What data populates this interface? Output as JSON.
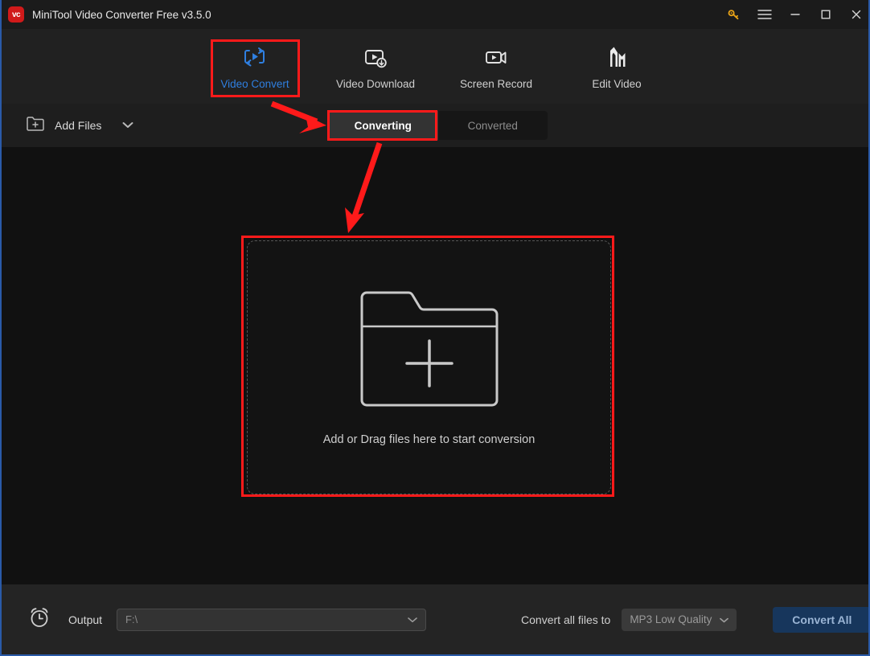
{
  "window": {
    "title": "MiniTool Video Converter Free v3.5.0",
    "logo_text": "vc",
    "accent_blue": "#2f7fe0",
    "annotation_red": "#ff1a1a",
    "logo_red": "#d01a1a",
    "controls": [
      {
        "name": "key-icon",
        "glyph": "key"
      },
      {
        "name": "menu-icon",
        "glyph": "hamburger"
      },
      {
        "name": "minimize-icon",
        "glyph": "minimize"
      },
      {
        "name": "maximize-icon",
        "glyph": "maximize"
      },
      {
        "name": "close-icon",
        "glyph": "close"
      }
    ]
  },
  "nav": {
    "items": [
      {
        "label": "Video Convert",
        "icon": "video-convert-icon",
        "active": true
      },
      {
        "label": "Video Download",
        "icon": "video-download-icon",
        "active": false
      },
      {
        "label": "Screen Record",
        "icon": "screen-record-icon",
        "active": false
      },
      {
        "label": "Edit Video",
        "icon": "edit-video-icon",
        "active": false
      }
    ]
  },
  "toolbar": {
    "add_files_label": "Add Files",
    "add_files_icon": "folder-plus-icon",
    "dropdown_icon": "chevron-down-icon",
    "tabs": [
      {
        "label": "Converting",
        "active": true
      },
      {
        "label": "Converted",
        "active": false
      }
    ]
  },
  "main": {
    "dropzone_label": "Add or Drag files here to start conversion",
    "dropzone_icon": "folder-plus-large-icon"
  },
  "bottom": {
    "clock_icon": "alarm-clock-icon",
    "output_label": "Output",
    "output_value": "F:\\",
    "convert_to_label": "Convert all files to",
    "format_value": "MP3 Low Quality",
    "convert_all_label": "Convert All"
  }
}
